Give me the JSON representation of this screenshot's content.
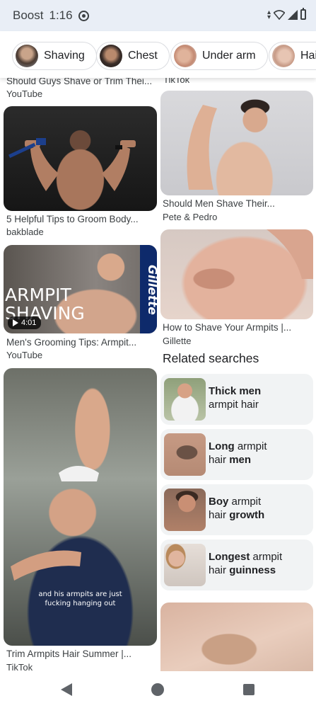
{
  "status_bar": {
    "carrier": "Boost",
    "time": "1:16",
    "icons": [
      "data-sync-icon",
      "data-arrows-icon",
      "wifi-icon",
      "signal-icon",
      "battery-icon"
    ]
  },
  "chips": [
    {
      "label": "Shaving",
      "icon": "avatar-thumbnail"
    },
    {
      "label": "Chest",
      "icon": "avatar-thumbnail"
    },
    {
      "label": "Under arm",
      "icon": "avatar-thumbnail"
    },
    {
      "label": "Hair",
      "icon": "avatar-thumbnail"
    }
  ],
  "results": {
    "top_left": {
      "title": "Should Guys Shave or Trim Thei...",
      "source": "YouTube"
    },
    "top_right": {
      "source": "TikTok"
    },
    "card1": {
      "title": "5 Helpful Tips to Groom Body...",
      "source": "bakblade"
    },
    "card2": {
      "title": "Should Men Shave Their...",
      "source": "Pete & Pedro"
    },
    "card3": {
      "title": "Men's Grooming Tips: Armpit...",
      "source": "YouTube",
      "overlay_line1": "ARMPIT",
      "overlay_line2": "SHAVING",
      "brand": "Gillette",
      "duration": "4:01"
    },
    "card4": {
      "title": "How to Shave Your Armpits |...",
      "source": "Gillette"
    },
    "card5": {
      "title": "Trim Armpits Hair Summer |...",
      "source": "TikTok",
      "caption_line1": "and his armpits are just",
      "caption_line2": "fucking hanging out"
    }
  },
  "related": {
    "heading": "Related searches",
    "items": [
      {
        "bold1": "Thick men",
        "rest1": "",
        "line2_pre": "armpit hair",
        "line2_bold": ""
      },
      {
        "bold1": "Long",
        "rest1": " armpit",
        "line2_pre": "hair ",
        "line2_bold": "men"
      },
      {
        "bold1": "Boy",
        "rest1": " armpit",
        "line2_pre": "hair ",
        "line2_bold": "growth"
      },
      {
        "bold1": "Longest",
        "rest1": " armpit",
        "line2_pre": "hair ",
        "line2_bold": "guinness"
      }
    ]
  },
  "nav": {
    "icons": [
      "back-icon",
      "home-icon",
      "recents-icon"
    ]
  },
  "colors": {
    "status_bg": "#e9eef6",
    "chip_border": "#dadce0",
    "related_bg": "#f1f3f4",
    "text_primary": "#202124",
    "text_secondary": "#3c4043"
  }
}
